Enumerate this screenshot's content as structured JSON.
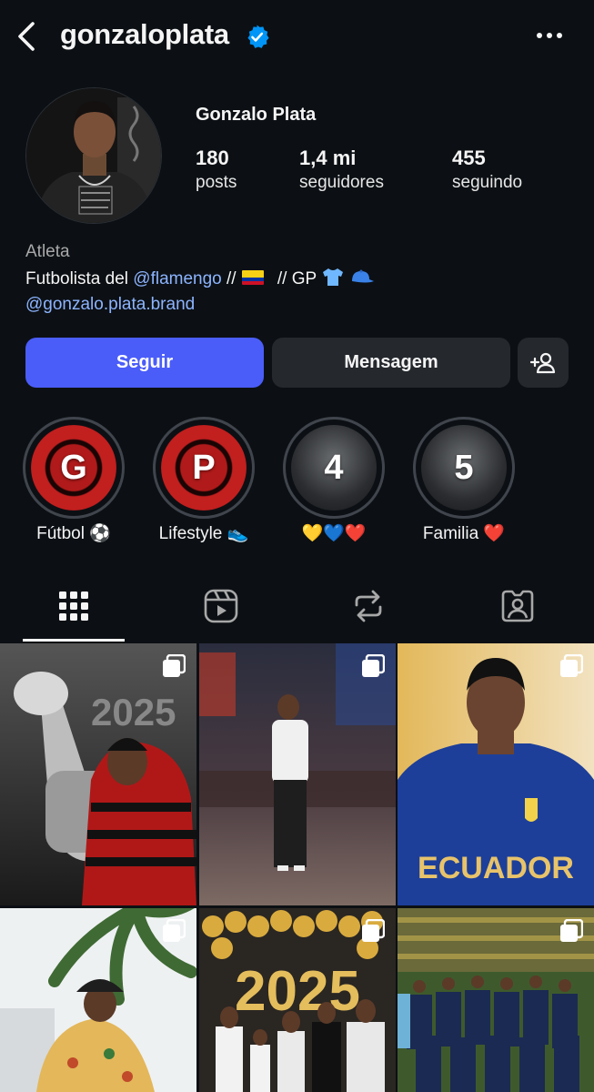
{
  "header": {
    "username": "gonzaloplata",
    "verified": true
  },
  "profile": {
    "display_name": "Gonzalo Plata",
    "stats": [
      {
        "value": "180",
        "label": "posts"
      },
      {
        "value": "1,4 mi",
        "label": "seguidores"
      },
      {
        "value": "455",
        "label": "seguindo"
      }
    ],
    "category": "Atleta",
    "bio": {
      "prefix": "Futbolista del ",
      "mention": "@flamengo",
      "middle": " //",
      "suffix": " // GP",
      "brand_link": "@gonzalo.plata.brand"
    }
  },
  "actions": {
    "follow": "Seguir",
    "message": "Mensagem"
  },
  "highlights": [
    {
      "letter": "G",
      "label": "Fútbol ⚽️",
      "style": "red"
    },
    {
      "letter": "P",
      "label": "Lifestyle 👟",
      "style": "red"
    },
    {
      "letter": "4",
      "label": "💛💙❤️",
      "style": "gray"
    },
    {
      "letter": "5",
      "label": "Familia ❤️",
      "style": "gray"
    }
  ],
  "tabs": [
    "grid",
    "reels",
    "reposts",
    "tagged"
  ],
  "posts": [
    {
      "name": "post-trophy-celebration",
      "text": "2025",
      "colors": [
        "#2b2b2b",
        "#6e6e6e"
      ]
    },
    {
      "name": "post-times-square",
      "colors": [
        "#1b1d2b",
        "#5a4a4a"
      ]
    },
    {
      "name": "post-ecuador-portrait",
      "text": "ECUADOR",
      "colors": [
        "#e0c48a",
        "#1d3a8a"
      ]
    },
    {
      "name": "post-palm-tree",
      "colors": [
        "#e8ecee",
        "#4a6b3a"
      ]
    },
    {
      "name": "post-2025-celebration",
      "text": "2025",
      "colors": [
        "#c89a3a",
        "#2a2a2a"
      ]
    },
    {
      "name": "post-team-photo",
      "colors": [
        "#3a5a2a",
        "#15223e"
      ]
    }
  ],
  "colors": {
    "background": "#0c1014",
    "accent": "#4a5df9",
    "link": "#8cb4ff",
    "verified": "#0095f6"
  }
}
